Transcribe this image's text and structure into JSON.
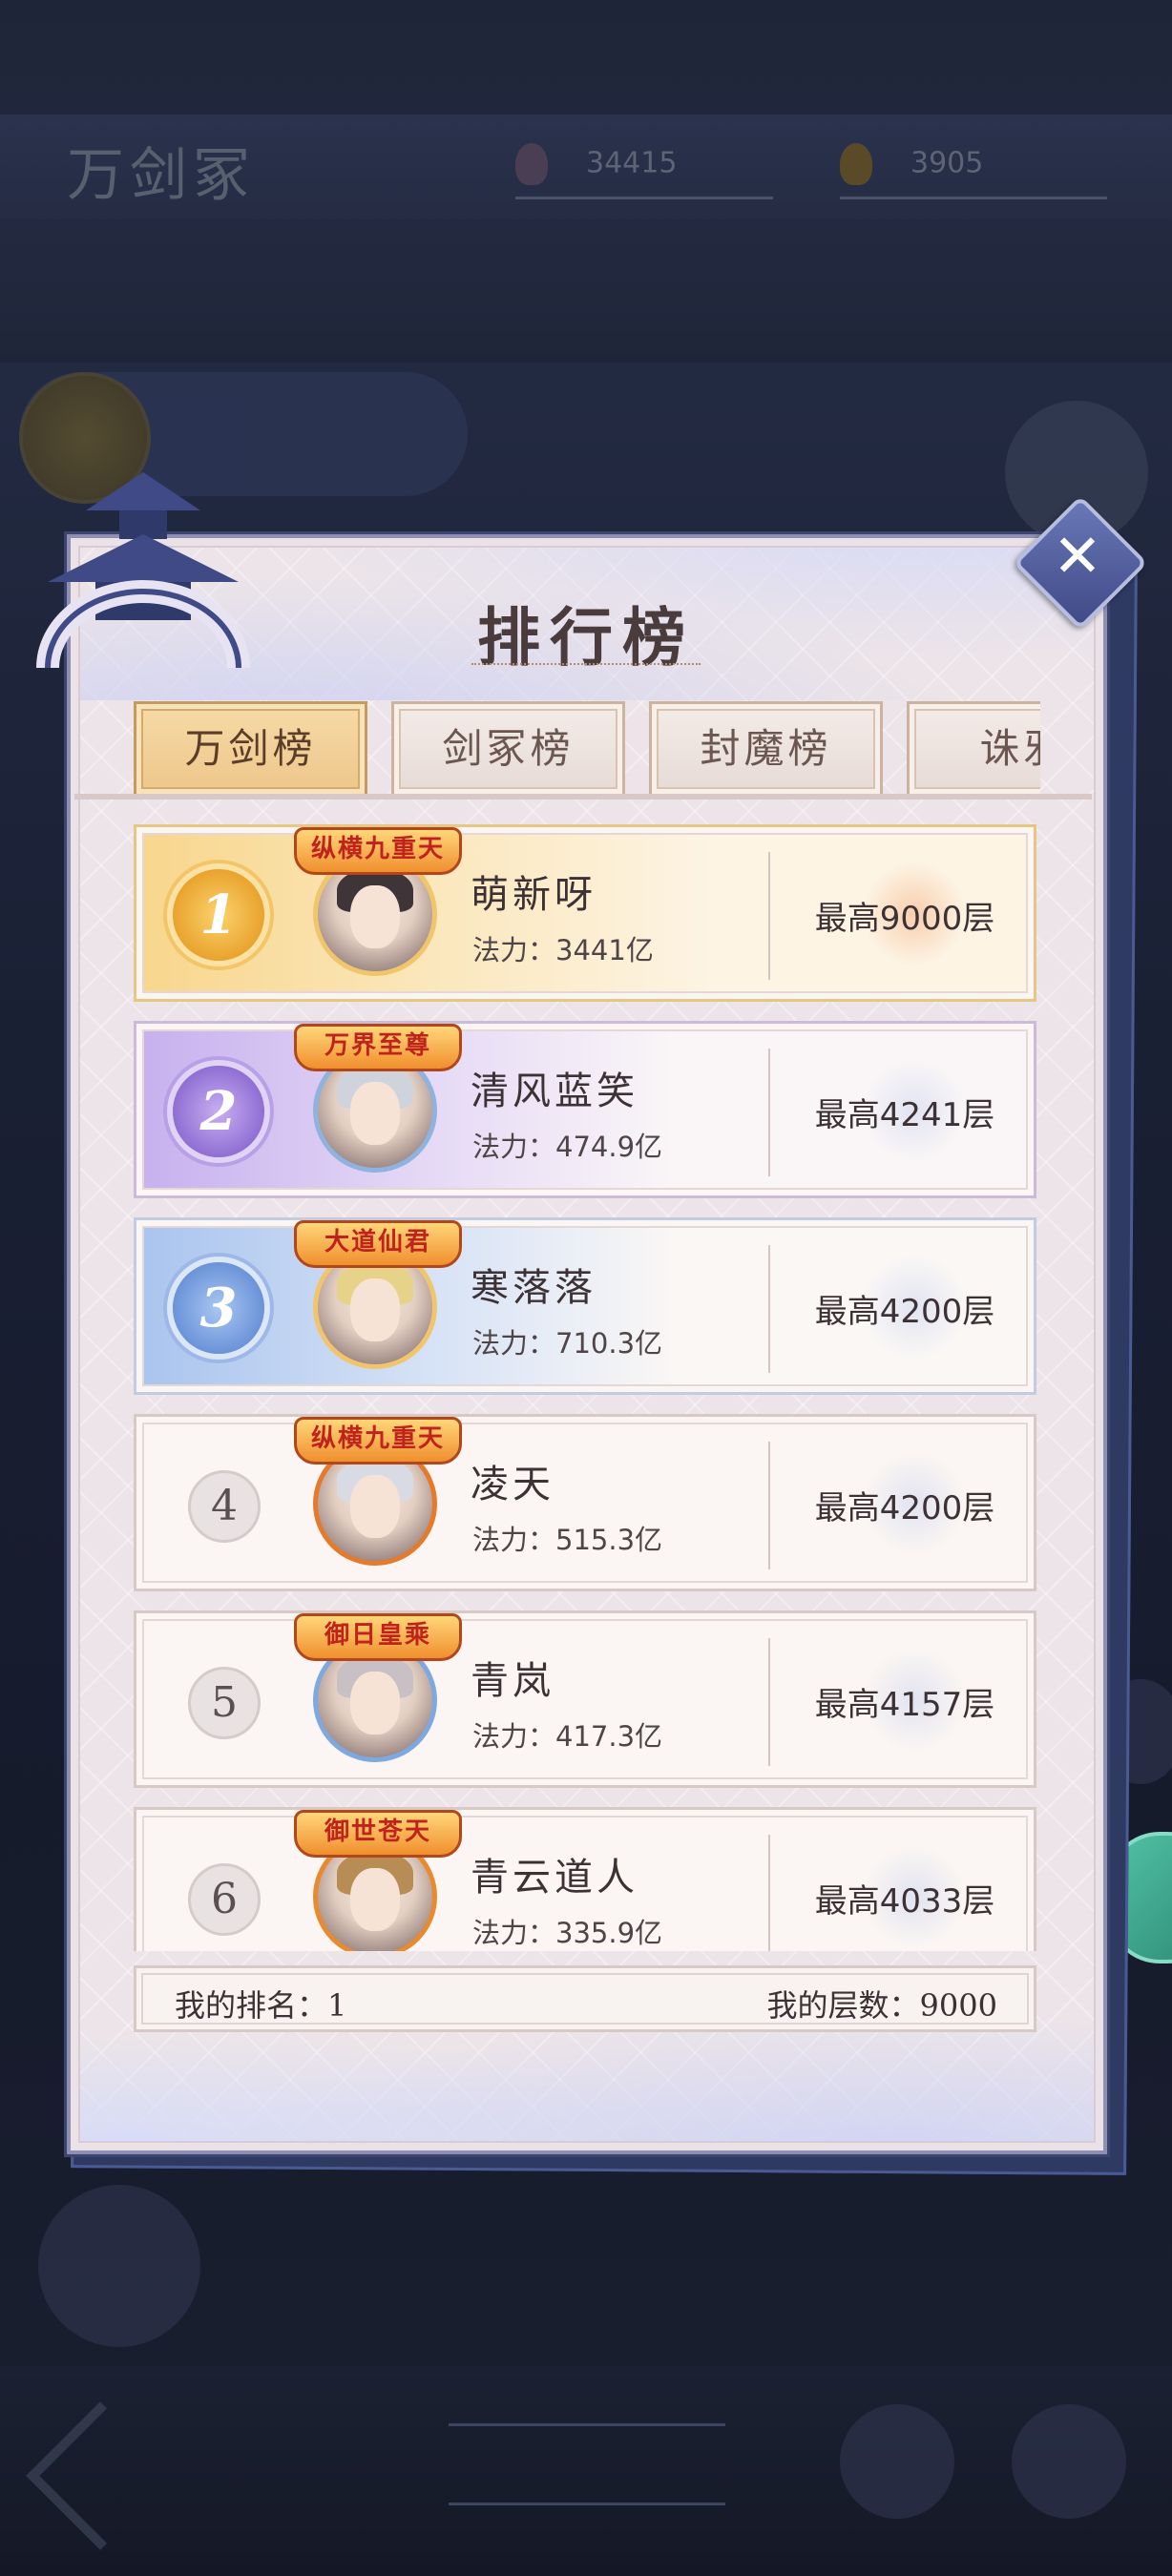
{
  "background": {
    "title": "万剑冢",
    "resource1": "34415",
    "resource2": "3905",
    "banner_lines": [
      "",
      ""
    ]
  },
  "panel": {
    "title": "排行榜",
    "close_label": "✕"
  },
  "tabs": [
    {
      "label": "万剑榜",
      "active": true
    },
    {
      "label": "剑冢榜",
      "active": false
    },
    {
      "label": "封魔榜",
      "active": false
    },
    {
      "label": "诛邪",
      "active": false
    }
  ],
  "rankings": [
    {
      "rank": "1",
      "badge": "纵横九重天",
      "name": "萌新呀",
      "power_label": "法力：",
      "power": "3441亿",
      "best": "最高9000层"
    },
    {
      "rank": "2",
      "badge": "万界至尊",
      "name": "清风蓝笑",
      "power_label": "法力：",
      "power": "474.9亿",
      "best": "最高4241层"
    },
    {
      "rank": "3",
      "badge": "大道仙君",
      "name": "寒落落",
      "power_label": "法力：",
      "power": "710.3亿",
      "best": "最高4200层"
    },
    {
      "rank": "4",
      "badge": "纵横九重天",
      "name": "凌天",
      "power_label": "法力：",
      "power": "515.3亿",
      "best": "最高4200层"
    },
    {
      "rank": "5",
      "badge": "御日皇乘",
      "name": "青岚",
      "power_label": "法力：",
      "power": "417.3亿",
      "best": "最高4157层"
    },
    {
      "rank": "6",
      "badge": "御世苍天",
      "name": "青云道人",
      "power_label": "法力：",
      "power": "335.9亿",
      "best": "最高4033层"
    }
  ],
  "footer": {
    "my_rank": "我的排名：1",
    "my_floors": "我的层数：9000"
  },
  "colors": {
    "panel_bg": "#ece4e8",
    "active_tab": "#f6dba6",
    "rank1": "#e9a32e",
    "rank2": "#8f6fd3",
    "rank3": "#6b93d8"
  }
}
